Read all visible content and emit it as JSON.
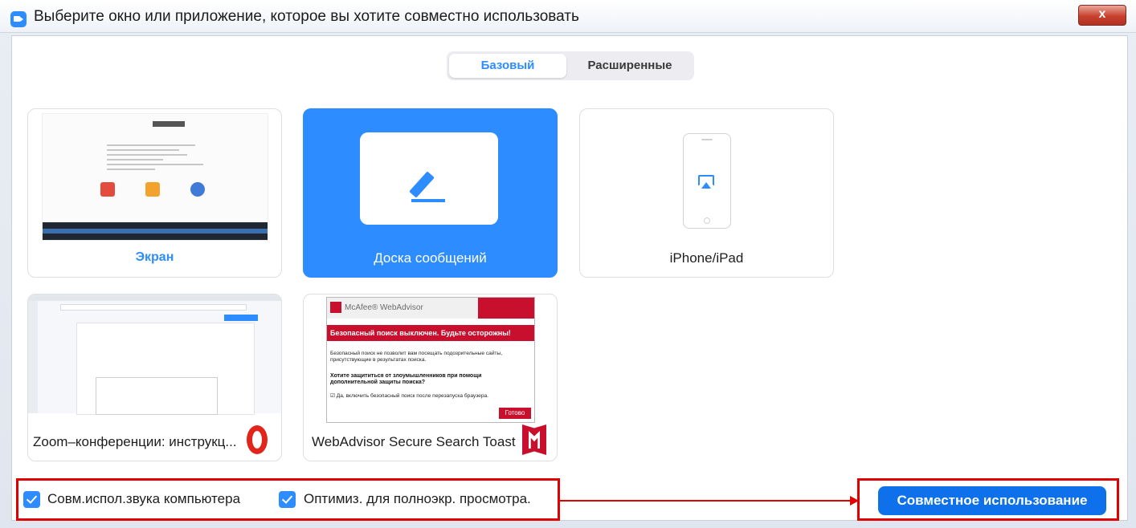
{
  "window": {
    "title": "Выберите окно или приложение, которое вы хотите совместно использовать",
    "close_label": "x"
  },
  "tabs": [
    {
      "label": "Базовый",
      "selected": true
    },
    {
      "label": "Расширенные",
      "selected": false
    }
  ],
  "cards": {
    "screen": {
      "label": "Экран"
    },
    "whiteboard": {
      "label": "Доска сообщений",
      "selected": true
    },
    "iphone": {
      "label": "iPhone/iPad"
    },
    "opera": {
      "label": "Zoom–конференции: инструкц...",
      "icon": "opera-icon"
    },
    "mcafee": {
      "label": "WebAdvisor Secure Search Toast",
      "icon": "mcafee-icon",
      "preview": {
        "header": "McAfee® WebAdvisor",
        "alert": "Безопасный поиск выключен. Будьте осторожны!",
        "body": "Безопасный поиск не позволит вам посещать подозрительные сайты, присутствующие в результатах поиска.",
        "question": "Хотите защититься от злоумышленников при помощи дополнительной защиты поиска?",
        "checkbox": "☑ Да, включить безопасный поиск после перезапуска браузера.",
        "done": "Готово"
      }
    }
  },
  "footer": {
    "share_audio": {
      "label": "Совм.испол.звука компьютера",
      "checked": true
    },
    "optimize": {
      "label": "Оптимиз. для полноэкр. просмотра.",
      "checked": true
    },
    "share_button": "Совместное использование"
  },
  "colors": {
    "accent": "#2d8cff",
    "annotation": "#e00000"
  }
}
